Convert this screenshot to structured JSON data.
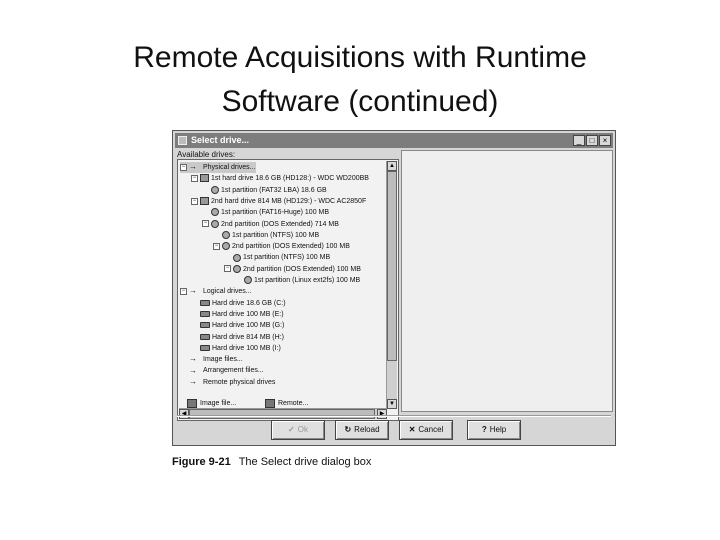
{
  "slide": {
    "title_line1": "Remote Acquisitions with Runtime",
    "title_line2": "Software (continued)"
  },
  "dialog": {
    "title": "Select drive...",
    "window_buttons": [
      "_",
      "□",
      "×"
    ],
    "available_label": "Available drives:",
    "tree": [
      {
        "label": "Physical drives...",
        "icon": "arrow-icon",
        "expander": "⊟"
      },
      {
        "label": "1st hard drive 18.6 GB (HD128:) - WDC WD200BB",
        "icon": "hard-drive-icon",
        "expander": "⊟"
      },
      {
        "label": "1st partition (FAT32 LBA) 18.6 GB",
        "icon": "partition-icon",
        "expander": ""
      },
      {
        "label": "2nd hard drive 814 MB (HD129:) - WDC AC2850F",
        "icon": "hard-drive-icon",
        "expander": "⊟"
      },
      {
        "label": "1st partition (FAT16-Huge) 100 MB",
        "icon": "partition-icon",
        "expander": ""
      },
      {
        "label": "2nd partition (DOS Extended) 714 MB",
        "icon": "partition-icon",
        "expander": "⊟"
      },
      {
        "label": "1st partition (NTFS) 100 MB",
        "icon": "partition-icon",
        "expander": ""
      },
      {
        "label": "2nd partition (DOS Extended) 100 MB",
        "icon": "partition-icon",
        "expander": "⊟"
      },
      {
        "label": "1st partition (NTFS) 100 MB",
        "icon": "partition-icon",
        "expander": ""
      },
      {
        "label": "2nd partition (DOS Extended) 100 MB",
        "icon": "partition-icon",
        "expander": "⊟"
      },
      {
        "label": "1st partition (Linux ext2fs) 100 MB",
        "icon": "partition-icon",
        "expander": ""
      },
      {
        "label": "Logical drives...",
        "icon": "arrow-icon",
        "expander": "⊟"
      },
      {
        "label": "Hard drive 18.6 GB (C:)",
        "icon": "drive-icon",
        "expander": ""
      },
      {
        "label": "Hard drive 100 MB (E:)",
        "icon": "drive-icon",
        "expander": ""
      },
      {
        "label": "Hard drive 100 MB (G:)",
        "icon": "drive-icon",
        "expander": ""
      },
      {
        "label": "Hard drive 814 MB (H:)",
        "icon": "drive-icon",
        "expander": ""
      },
      {
        "label": "Hard drive 100 MB (I:)",
        "icon": "drive-icon",
        "expander": ""
      },
      {
        "label": "Image files...",
        "icon": "arrow-icon",
        "expander": ""
      },
      {
        "label": "Arrangement files...",
        "icon": "arrow-icon",
        "expander": ""
      },
      {
        "label": "Remote physical drives",
        "icon": "arrow-icon",
        "expander": ""
      }
    ],
    "toolbar": {
      "image_file": "Image file...",
      "remote": "Remote..."
    },
    "buttons": {
      "ok": "Ok",
      "reload": "Reload",
      "cancel": "Cancel",
      "help": "Help"
    }
  },
  "caption": {
    "figure": "Figure 9-21",
    "text": "The Select drive dialog box"
  }
}
